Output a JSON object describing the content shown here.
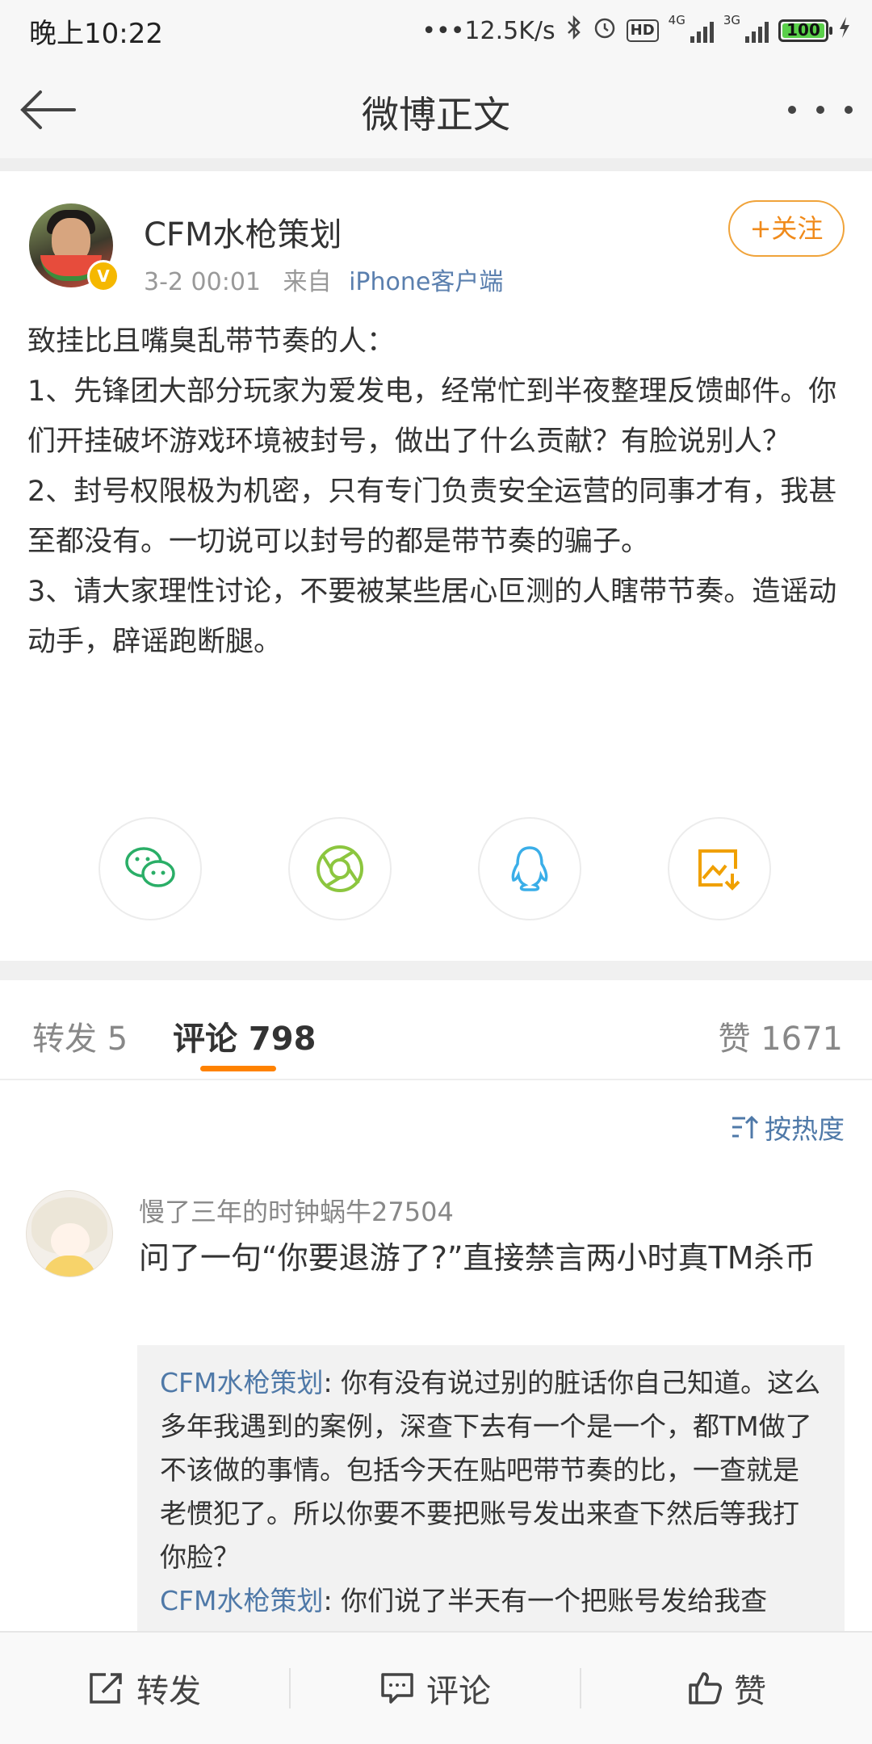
{
  "status_bar": {
    "time": "晚上10:22",
    "network_speed": "12.5K/s",
    "hd": "HD",
    "net1": "4G",
    "net2": "3G",
    "battery": "100"
  },
  "nav": {
    "title": "微博正文"
  },
  "post": {
    "author": "CFM水枪策划",
    "timestamp": "3-2 00:01",
    "source_prefix": "来自",
    "source": "iPhone客户端",
    "follow_label": "+关注",
    "paragraphs": [
      "致挂比且嘴臭乱带节奏的人：",
      "1、先锋团大部分玩家为爱发电，经常忙到半夜整理反馈邮件。你们开挂破坏游戏环境被封号，做出了什么贡献？有脸说别人？",
      "2、封号权限极为机密，只有专门负责安全运营的同事才有，我甚至都没有。一切说可以封号的都是带节奏的骗子。",
      "3、请大家理性讨论，不要被某些居心叵测的人瞎带节奏。造谣动动手，辟谣跑断腿。"
    ]
  },
  "tabs": {
    "repost": "转发 5",
    "comment": "评论 798",
    "like": "赞 1671"
  },
  "sort_label": "按热度",
  "comment": {
    "user": "慢了三年的时钟蜗牛27504",
    "text": "问了一句“你要退游了?”直接禁言两小时真TM杀币",
    "replies": [
      {
        "author": "CFM水枪策划",
        "text": ": 你有没有说过别的脏话你自己知道。这么多年我遇到的案例，深查下去有一个是一个，都TM做了不该做的事情。包括今天在贴吧带节奏的比，一查就是老惯犯了。所以你要不要把账号发出来查下然后等我打你脸？"
      },
      {
        "author": "CFM水枪策划",
        "text": ": 你们说了半天有一个把账号发给我查"
      }
    ]
  },
  "bottom_bar": {
    "repost": "转发",
    "comment": "评论",
    "like": "赞"
  },
  "colors": {
    "accent": "#ff8200",
    "link": "#4f79a8",
    "wechat": "#2aae67",
    "moments": "#8cc63f",
    "qq": "#3aaee8",
    "save": "#f0a000"
  }
}
